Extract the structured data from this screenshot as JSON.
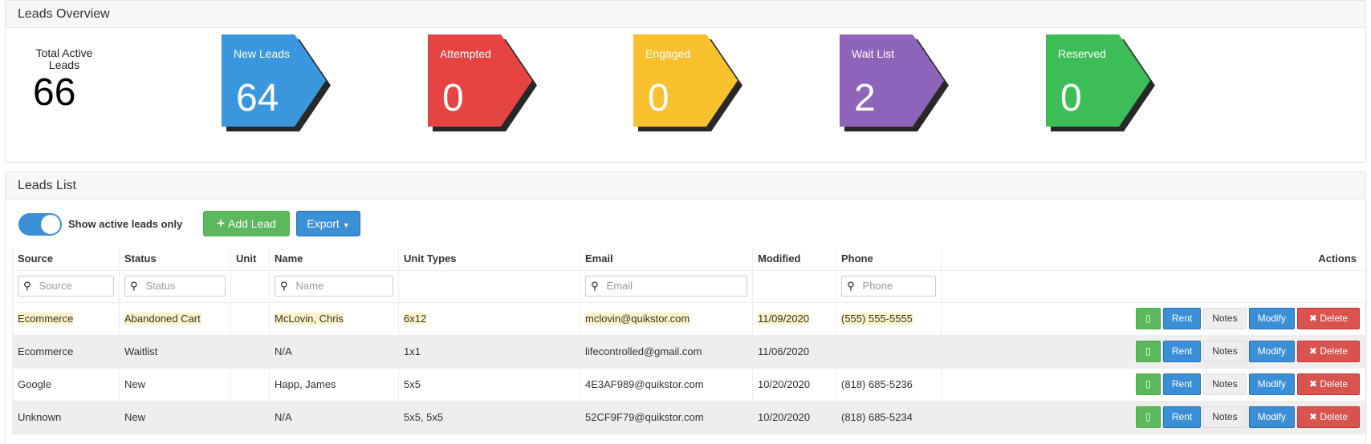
{
  "overview": {
    "title": "Leads Overview",
    "total_label": "Total Active Leads",
    "total_value": "66",
    "stats": [
      {
        "title": "New Leads",
        "value": "64",
        "color": "#3a96dd"
      },
      {
        "title": "Attempted",
        "value": "0",
        "color": "#e64343"
      },
      {
        "title": "Engaged",
        "value": "0",
        "color": "#f9c12e"
      },
      {
        "title": "Wait List",
        "value": "2",
        "color": "#8e64ba"
      },
      {
        "title": "Reserved",
        "value": "0",
        "color": "#3dbd58"
      }
    ]
  },
  "list": {
    "title": "Leads List",
    "toggle_label": "Show active leads only",
    "add_lead_label": "Add Lead",
    "export_label": "Export",
    "columns": [
      "Source",
      "Status",
      "Unit",
      "Name",
      "Unit Types",
      "Email",
      "Modified",
      "Phone",
      "Actions"
    ],
    "filters": {
      "source": "Source",
      "status": "Status",
      "name": "Name",
      "email": "Email",
      "phone": "Phone"
    },
    "action_labels": {
      "rent": "Rent",
      "notes": "Notes",
      "modify": "Modify",
      "delete": "Delete"
    },
    "rows": [
      {
        "source": "Ecommerce",
        "status": "Abandoned Cart",
        "unit": "",
        "name": "McLovin, Chris",
        "unit_types": "6x12",
        "email": "mclovin@quikstor.com",
        "modified": "11/09/2020",
        "phone": "(555) 555-5555"
      },
      {
        "source": "Ecommerce",
        "status": "Waitlist",
        "unit": "",
        "name": "N/A",
        "unit_types": "1x1",
        "email": "lifecontrolled@gmail.com",
        "modified": "11/06/2020",
        "phone": ""
      },
      {
        "source": "Google",
        "status": "New",
        "unit": "",
        "name": "Happ, James",
        "unit_types": "5x5",
        "email": "4E3AF989@quikstor.com",
        "modified": "10/20/2020",
        "phone": "(818) 685-5236"
      },
      {
        "source": "Unknown",
        "status": "New",
        "unit": "",
        "name": "N/A",
        "unit_types": "5x5, 5x5",
        "email": "52CF9F79@quikstor.com",
        "modified": "10/20/2020",
        "phone": "(818) 685-5234"
      }
    ]
  }
}
